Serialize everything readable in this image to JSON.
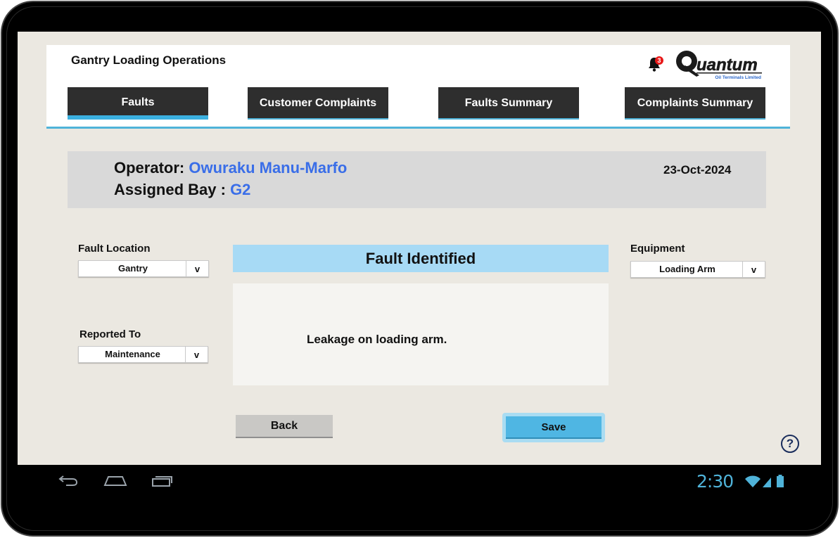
{
  "app": {
    "title": "Gantry Loading Operations",
    "notification_count": "3",
    "logo": {
      "brand": "Quantum",
      "subtitle": "Oil Terminals Limited"
    }
  },
  "tabs": [
    {
      "label": "Faults",
      "active": true
    },
    {
      "label": "Customer Complaints",
      "active": false
    },
    {
      "label": "Faults Summary",
      "active": false
    },
    {
      "label": "Complaints Summary",
      "active": false
    }
  ],
  "operator": {
    "operator_label": "Operator:",
    "operator_name": "Owuraku Manu-Marfo",
    "bay_label": "Assigned Bay :",
    "bay_value": "G2",
    "date": "23-Oct-2024"
  },
  "form": {
    "fault_location": {
      "label": "Fault Location",
      "value": "Gantry",
      "arrow": "v"
    },
    "reported_to": {
      "label": "Reported To",
      "value": "Maintenance",
      "arrow": "v"
    },
    "equipment": {
      "label": "Equipment",
      "value": "Loading Arm",
      "arrow": "v"
    },
    "fault_identified": {
      "header": "Fault Identified",
      "text": "Leakage on loading arm."
    }
  },
  "actions": {
    "back_label": "Back",
    "save_label": "Save",
    "help_label": "?"
  },
  "system_bar": {
    "time": "2:30",
    "icons": [
      "back-icon",
      "home-icon",
      "recents-icon",
      "wifi-icon",
      "signal-icon",
      "battery-icon"
    ]
  },
  "colors": {
    "accent": "#4fb3d9",
    "tab_bg": "#2e2e2e",
    "operator_value": "#3a6ee8",
    "fault_header_bg": "#a7daf5",
    "save_bg": "#4fb6e3",
    "badge": "#e81919"
  }
}
